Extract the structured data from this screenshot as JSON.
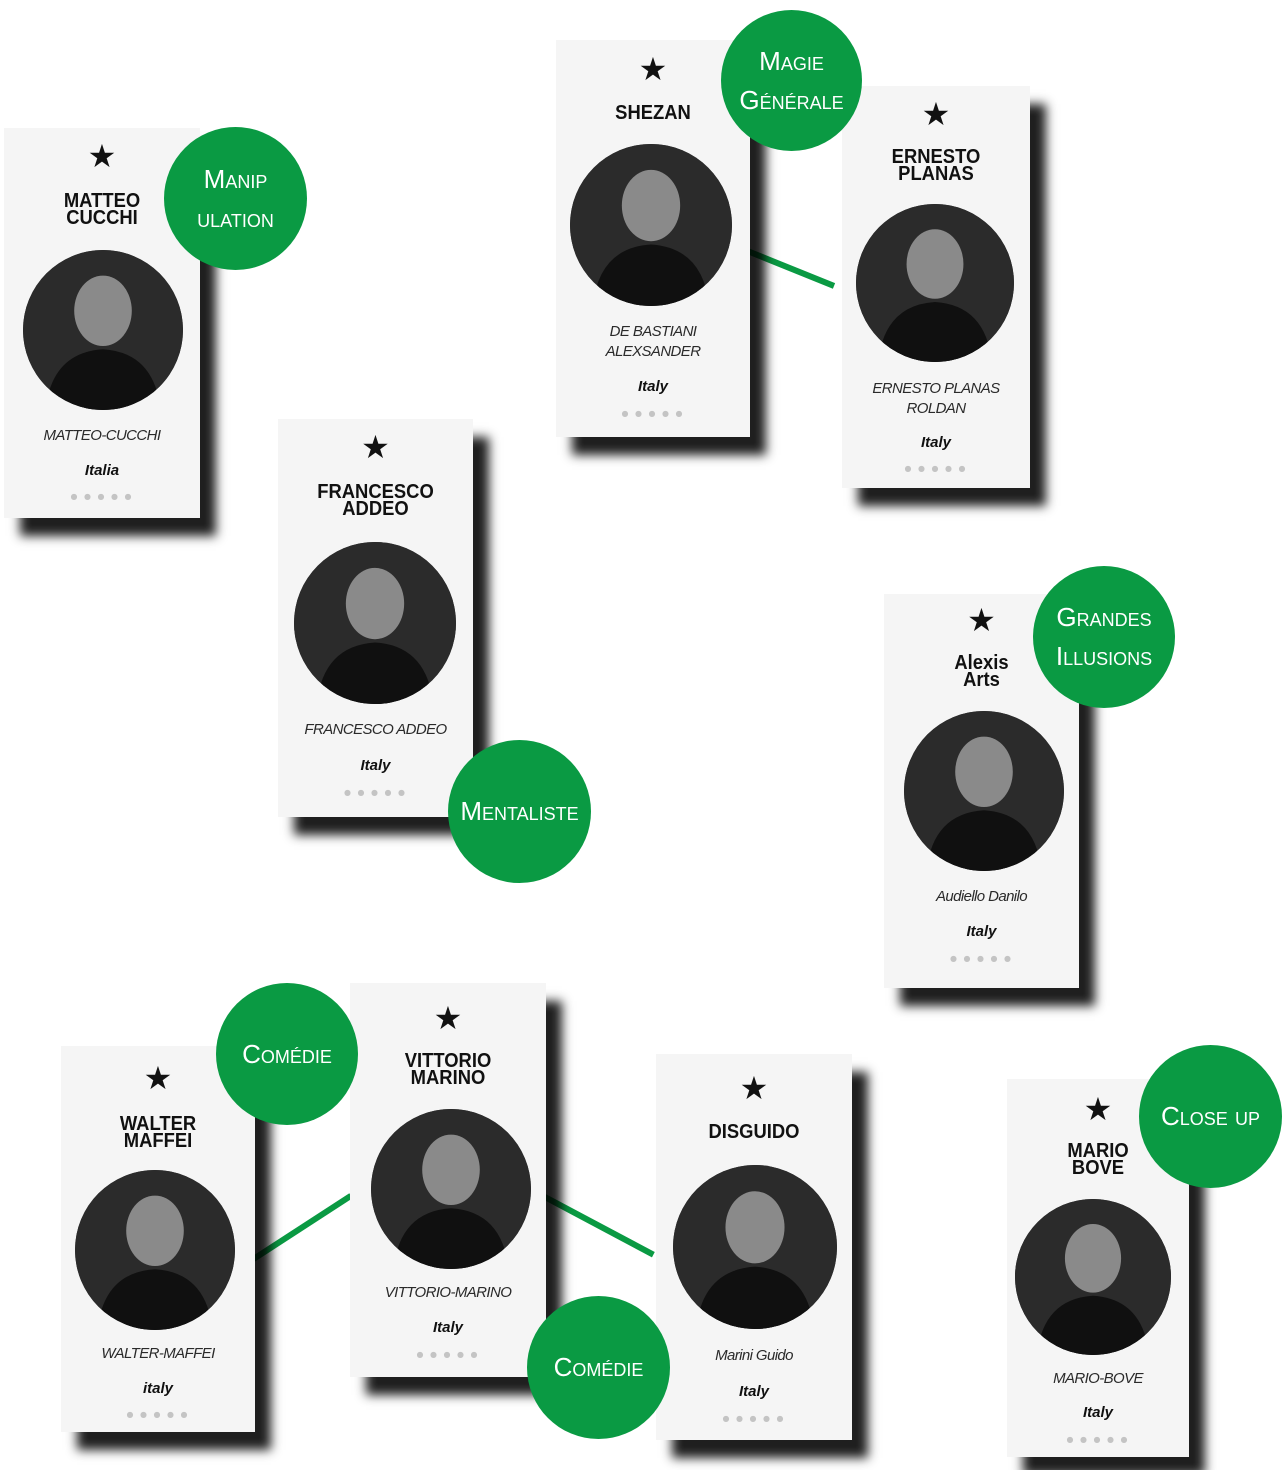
{
  "colors": {
    "badge_green": "#0a9a43",
    "card_bg": "#f5f5f5",
    "shadow": "#000000"
  },
  "star_glyph": "★",
  "rating_dots": "● ● ● ● ●",
  "cards": {
    "matteo": {
      "name": "MATTEO\nCUCCHI",
      "subtitle": "MATTEO-CUCCHI",
      "country": "Italia"
    },
    "shezan": {
      "name": "SHEZAN",
      "subtitle": "DE BASTIANI\nALEXSANDER",
      "country": "Italy"
    },
    "ernesto": {
      "name": "ERNESTO\nPLANAS",
      "subtitle": "ERNESTO PLANAS\nROLDAN",
      "country": "Italy"
    },
    "francesco": {
      "name": "FRANCESCO\nADDEO",
      "subtitle": "FRANCESCO ADDEO",
      "country": "Italy"
    },
    "alexis": {
      "name": "Alexis\nArts",
      "subtitle": "Audiello Danilo",
      "country": "Italy"
    },
    "walter": {
      "name": "WALTER\nMAFFEI",
      "subtitle": "WALTER-MAFFEI",
      "country": "italy"
    },
    "vittorio": {
      "name": "VITTORIO\nMARINO",
      "subtitle": "VITTORIO-MARINO",
      "country": "Italy"
    },
    "disguido": {
      "name": "DISGUIDO",
      "subtitle": "Marini Guido",
      "country": "Italy"
    },
    "mario": {
      "name": "MARIO\nBOVE",
      "subtitle": "MARIO-BOVE",
      "country": "Italy"
    }
  },
  "badges": {
    "manipulation": "Manip\nulation",
    "magie_generale": "Magie\nGénérale",
    "mentaliste": "Mentaliste",
    "grandes_illusions": "Grandes\nIllusions",
    "comedie_1": "Comédie",
    "comedie_2": "Comédie",
    "close_up": "Close up"
  }
}
